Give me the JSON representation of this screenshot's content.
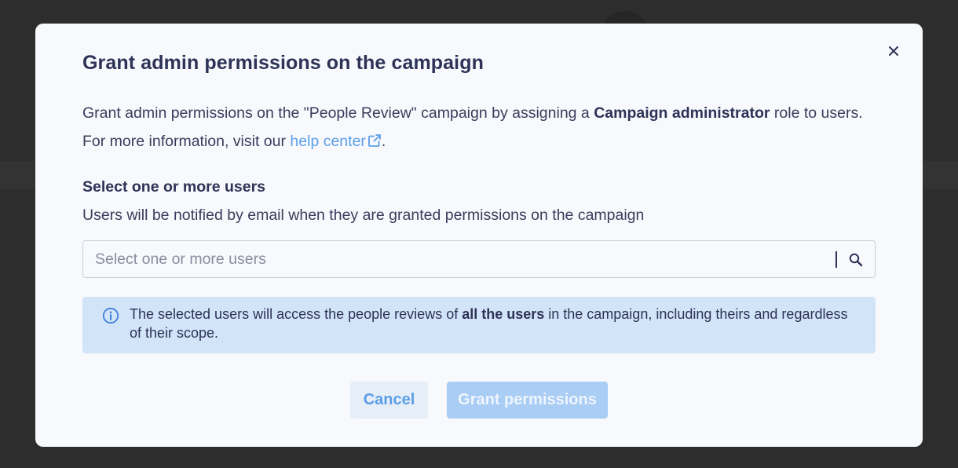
{
  "modal": {
    "title": "Grant admin permissions on the campaign",
    "close_icon": "close-icon",
    "intro": {
      "text_before": "Grant admin permissions on the \"People Review\" campaign by assigning a ",
      "role_name": "Campaign administrator",
      "text_after": " role to users. For more information, visit our ",
      "link_text": "help center",
      "link_icon": "external-link-icon",
      "end_text": "."
    },
    "user_select": {
      "label": "Select one or more users",
      "hint": "Users will be notified by email when they are granted permissions on the campaign",
      "placeholder": "Select one or more users",
      "value": "",
      "icon": "search-icon"
    },
    "info_banner": {
      "icon": "info-icon",
      "text_before": "The selected users will access the people reviews of ",
      "emphasis": "all the users",
      "text_after": " in the campaign, including theirs and regardless of their scope."
    },
    "actions": {
      "cancel_label": "Cancel",
      "grant_label": "Grant permissions",
      "grant_disabled": true
    }
  },
  "colors": {
    "backdrop": "#2d2d2d",
    "modal_background": "#f7f9fc",
    "text_primary": "#2e3257",
    "link": "#5b9ee8",
    "info_banner_background": "#d2e4f8",
    "primary_button_disabled": "#a9cdf4"
  }
}
